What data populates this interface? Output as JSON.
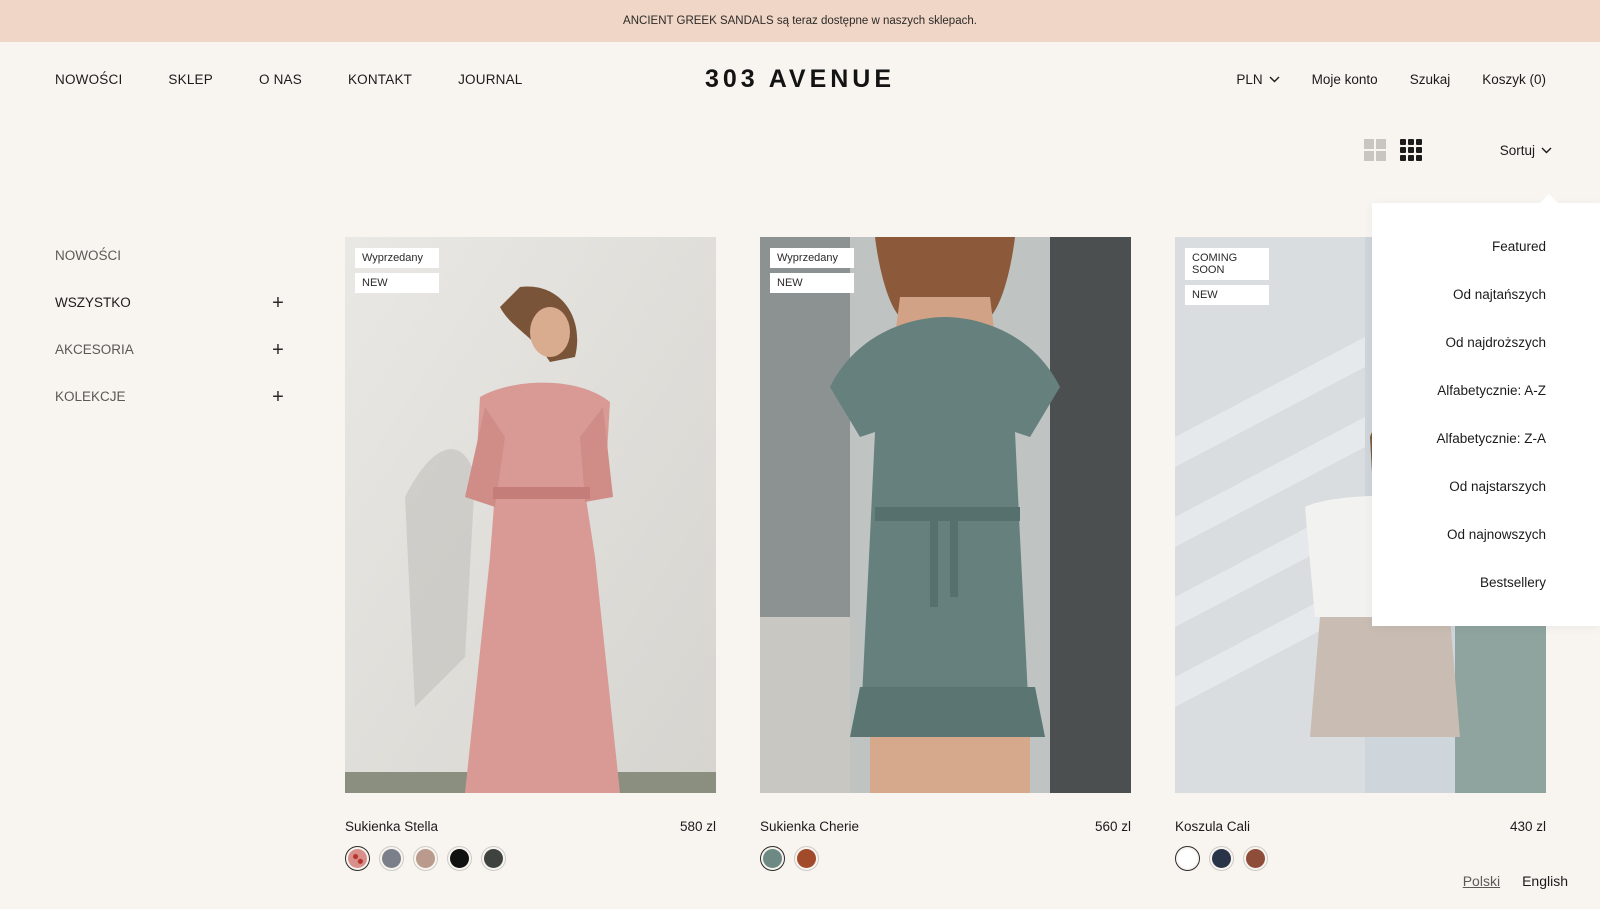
{
  "announcement": "ANCIENT GREEK SANDALS są teraz dostępne w naszych sklepach.",
  "nav": {
    "left": [
      "NOWOŚCI",
      "SKLEP",
      "O NAS",
      "KONTAKT",
      "JOURNAL"
    ],
    "logo": "303 AVENUE",
    "currency": "PLN",
    "account": "Moje konto",
    "search": "Szukaj",
    "cart": "Koszyk (0)"
  },
  "toolbar": {
    "sort_label": "Sortuj"
  },
  "sidebar": {
    "items": [
      {
        "label": "NOWOŚCI",
        "expandable": false
      },
      {
        "label": "WSZYSTKO",
        "expandable": true,
        "plus": "+"
      },
      {
        "label": "AKCESORIA",
        "expandable": true,
        "plus": "+"
      },
      {
        "label": "KOLEKCJE",
        "expandable": true,
        "plus": "+"
      }
    ]
  },
  "products": [
    {
      "name": "Sukienka Stella",
      "price": "580 zl",
      "badges": [
        "Wyprzedany",
        "NEW"
      ],
      "swatches": [
        "#d98f8a",
        "#7b7f8a",
        "#b99a8c",
        "#111111",
        "#3f433f"
      ]
    },
    {
      "name": "Sukienka Cherie",
      "price": "560 zl",
      "badges": [
        "Wyprzedany",
        "NEW"
      ],
      "swatches": [
        "#6d8983",
        "#a14b2b"
      ]
    },
    {
      "name": "Koszula Cali",
      "price": "430 zl",
      "badges": [
        "COMING SOON",
        "NEW"
      ],
      "swatches": [
        "#ffffff",
        "#2a3448",
        "#8e4d39"
      ]
    }
  ],
  "sort_options": [
    "Featured",
    "Od najtańszych",
    "Od najdroższych",
    "Alfabetycznie: A-Z",
    "Alfabetycznie: Z-A",
    "Od najstarszych",
    "Od najnowszych",
    "Bestsellery"
  ],
  "languages": {
    "active": "Polski",
    "other": "English"
  },
  "colors": {
    "announcement_bg": "#efd6c6",
    "page_bg": "#f8f5f1"
  }
}
